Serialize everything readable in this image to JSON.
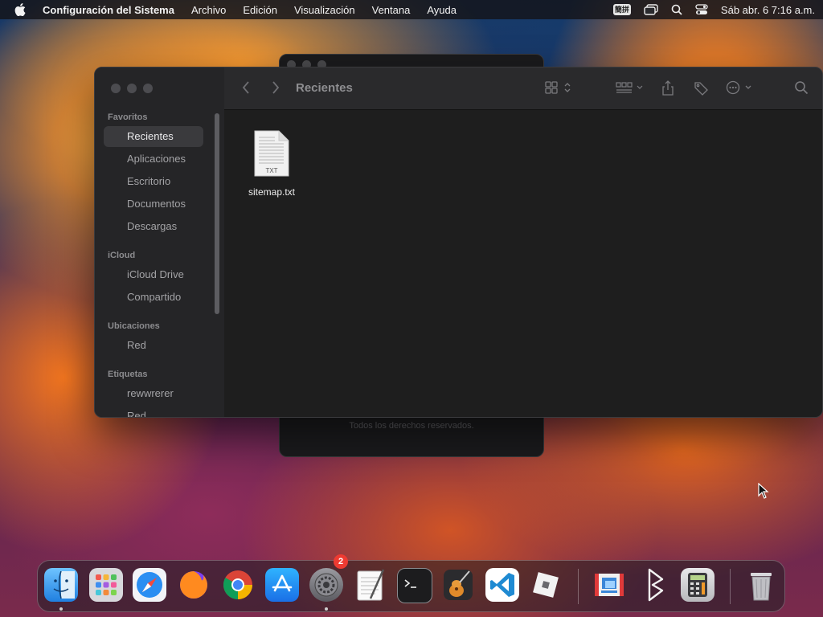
{
  "menubar": {
    "app_name": "Configuración del Sistema",
    "menus": [
      "Archivo",
      "Edición",
      "Visualización",
      "Ventana",
      "Ayuda"
    ],
    "ime_label": "簡拼",
    "clock": "Sáb abr. 6  7:16 a.m."
  },
  "background_window": {
    "footer": "Todos los derechos reservados."
  },
  "finder": {
    "title": "Recientes",
    "sidebar": {
      "sections": [
        {
          "label": "Favoritos",
          "items": [
            "Recientes",
            "Aplicaciones",
            "Escritorio",
            "Documentos",
            "Descargas"
          ]
        },
        {
          "label": "iCloud",
          "items": [
            "iCloud Drive",
            "Compartido"
          ]
        },
        {
          "label": "Ubicaciones",
          "items": [
            "Red"
          ]
        },
        {
          "label": "Etiquetas",
          "items": [
            "rewwrerer",
            "Red"
          ]
        }
      ],
      "selected": "Recientes"
    },
    "files": [
      {
        "name": "sitemap.txt",
        "type_label": "TXT"
      }
    ]
  },
  "dock": {
    "apps": [
      "Finder",
      "Launchpad",
      "Safari",
      "Firefox",
      "Chrome",
      "App Store",
      "Configuración del Sistema",
      "TextEdit",
      "Terminal",
      "GarageBand",
      "Visual Studio Code",
      "Roblox",
      "Remote Desktop",
      "Bezel",
      "Calculadora",
      "Papelera"
    ],
    "badge_count": "2"
  }
}
